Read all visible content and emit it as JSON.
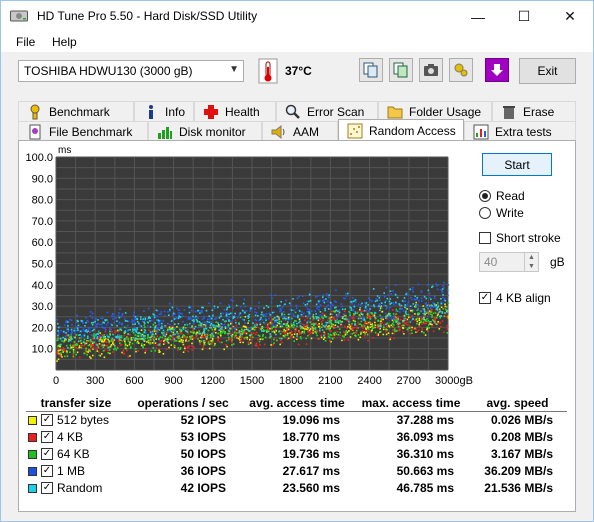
{
  "window": {
    "title": "HD Tune Pro 5.50 - Hard Disk/SSD Utility",
    "minimize": "—",
    "maximize": "☐",
    "close": "✕"
  },
  "menu": {
    "file": "File",
    "help": "Help"
  },
  "toolbar": {
    "drive": "TOSHIBA HDWU130 (3000 gB)",
    "temperature": "37°C",
    "exit_label": "Exit"
  },
  "tabs_top": [
    {
      "label": "Benchmark",
      "icon": "benchmark-icon"
    },
    {
      "label": "Info",
      "icon": "info-icon"
    },
    {
      "label": "Health",
      "icon": "health-icon"
    },
    {
      "label": "Error Scan",
      "icon": "error-scan-icon"
    },
    {
      "label": "Folder Usage",
      "icon": "folder-icon"
    },
    {
      "label": "Erase",
      "icon": "erase-icon"
    }
  ],
  "tabs_bottom": [
    {
      "label": "File Benchmark",
      "icon": "file-benchmark-icon"
    },
    {
      "label": "Disk monitor",
      "icon": "disk-monitor-icon"
    },
    {
      "label": "AAM",
      "icon": "aam-icon"
    },
    {
      "label": "Random Access",
      "icon": "random-access-icon",
      "active": true
    },
    {
      "label": "Extra tests",
      "icon": "extra-tests-icon"
    }
  ],
  "controls": {
    "start_label": "Start",
    "read_label": "Read",
    "write_label": "Write",
    "mode": "read",
    "short_stroke_label": "Short stroke",
    "short_stroke_checked": false,
    "short_stroke_value": "40",
    "short_stroke_unit": "gB",
    "align_label": "4 KB align",
    "align_checked": true
  },
  "chart_data": {
    "type": "scatter",
    "ylabel": "ms",
    "xlabel": "",
    "ylim": [
      0,
      100
    ],
    "xlim": [
      0,
      3000
    ],
    "yticks": [
      "100.0",
      "90.0",
      "80.0",
      "70.0",
      "60.0",
      "50.0",
      "40.0",
      "30.0",
      "20.0",
      "10.0"
    ],
    "xticks": [
      "0",
      "300",
      "600",
      "900",
      "1200",
      "1500",
      "1800",
      "2100",
      "2400",
      "2700",
      "3000gB"
    ],
    "grid": true,
    "background": "#3a3a3a",
    "series": [
      {
        "name": "512 bytes",
        "color": "#f2f200",
        "access_ms_at_start": [
          4,
          18
        ],
        "access_ms_at_end": [
          16,
          34
        ]
      },
      {
        "name": "4 KB",
        "color": "#ff2020",
        "access_ms_at_start": [
          4,
          18
        ],
        "access_ms_at_end": [
          16,
          33
        ]
      },
      {
        "name": "64 KB",
        "color": "#20e020",
        "access_ms_at_start": [
          5,
          19
        ],
        "access_ms_at_end": [
          17,
          34
        ]
      },
      {
        "name": "1 MB",
        "color": "#2060ff",
        "access_ms_at_start": [
          12,
          27
        ],
        "access_ms_at_end": [
          24,
          44
        ]
      },
      {
        "name": "Random",
        "color": "#20d8e8",
        "access_ms_at_start": [
          8,
          26
        ],
        "access_ms_at_end": [
          20,
          42
        ]
      }
    ]
  },
  "results": {
    "headers": [
      "transfer size",
      "operations / sec",
      "avg. access time",
      "max. access time",
      "avg. speed"
    ],
    "rows": [
      {
        "size": "512 bytes",
        "color": "#f2f200",
        "ops": "52 IOPS",
        "avg": "19.096 ms",
        "max": "37.288 ms",
        "speed": "0.026 MB/s"
      },
      {
        "size": "4 KB",
        "color": "#e82020",
        "ops": "53 IOPS",
        "avg": "18.770 ms",
        "max": "36.093 ms",
        "speed": "0.208 MB/s"
      },
      {
        "size": "64 KB",
        "color": "#20c020",
        "ops": "50 IOPS",
        "avg": "19.736 ms",
        "max": "36.310 ms",
        "speed": "3.167 MB/s"
      },
      {
        "size": "1 MB",
        "color": "#2050e0",
        "ops": "36 IOPS",
        "avg": "27.617 ms",
        "max": "50.663 ms",
        "speed": "36.209 MB/s"
      },
      {
        "size": "Random",
        "color": "#20d0e8",
        "ops": "42 IOPS",
        "avg": "23.560 ms",
        "max": "46.785 ms",
        "speed": "21.536 MB/s"
      }
    ]
  }
}
